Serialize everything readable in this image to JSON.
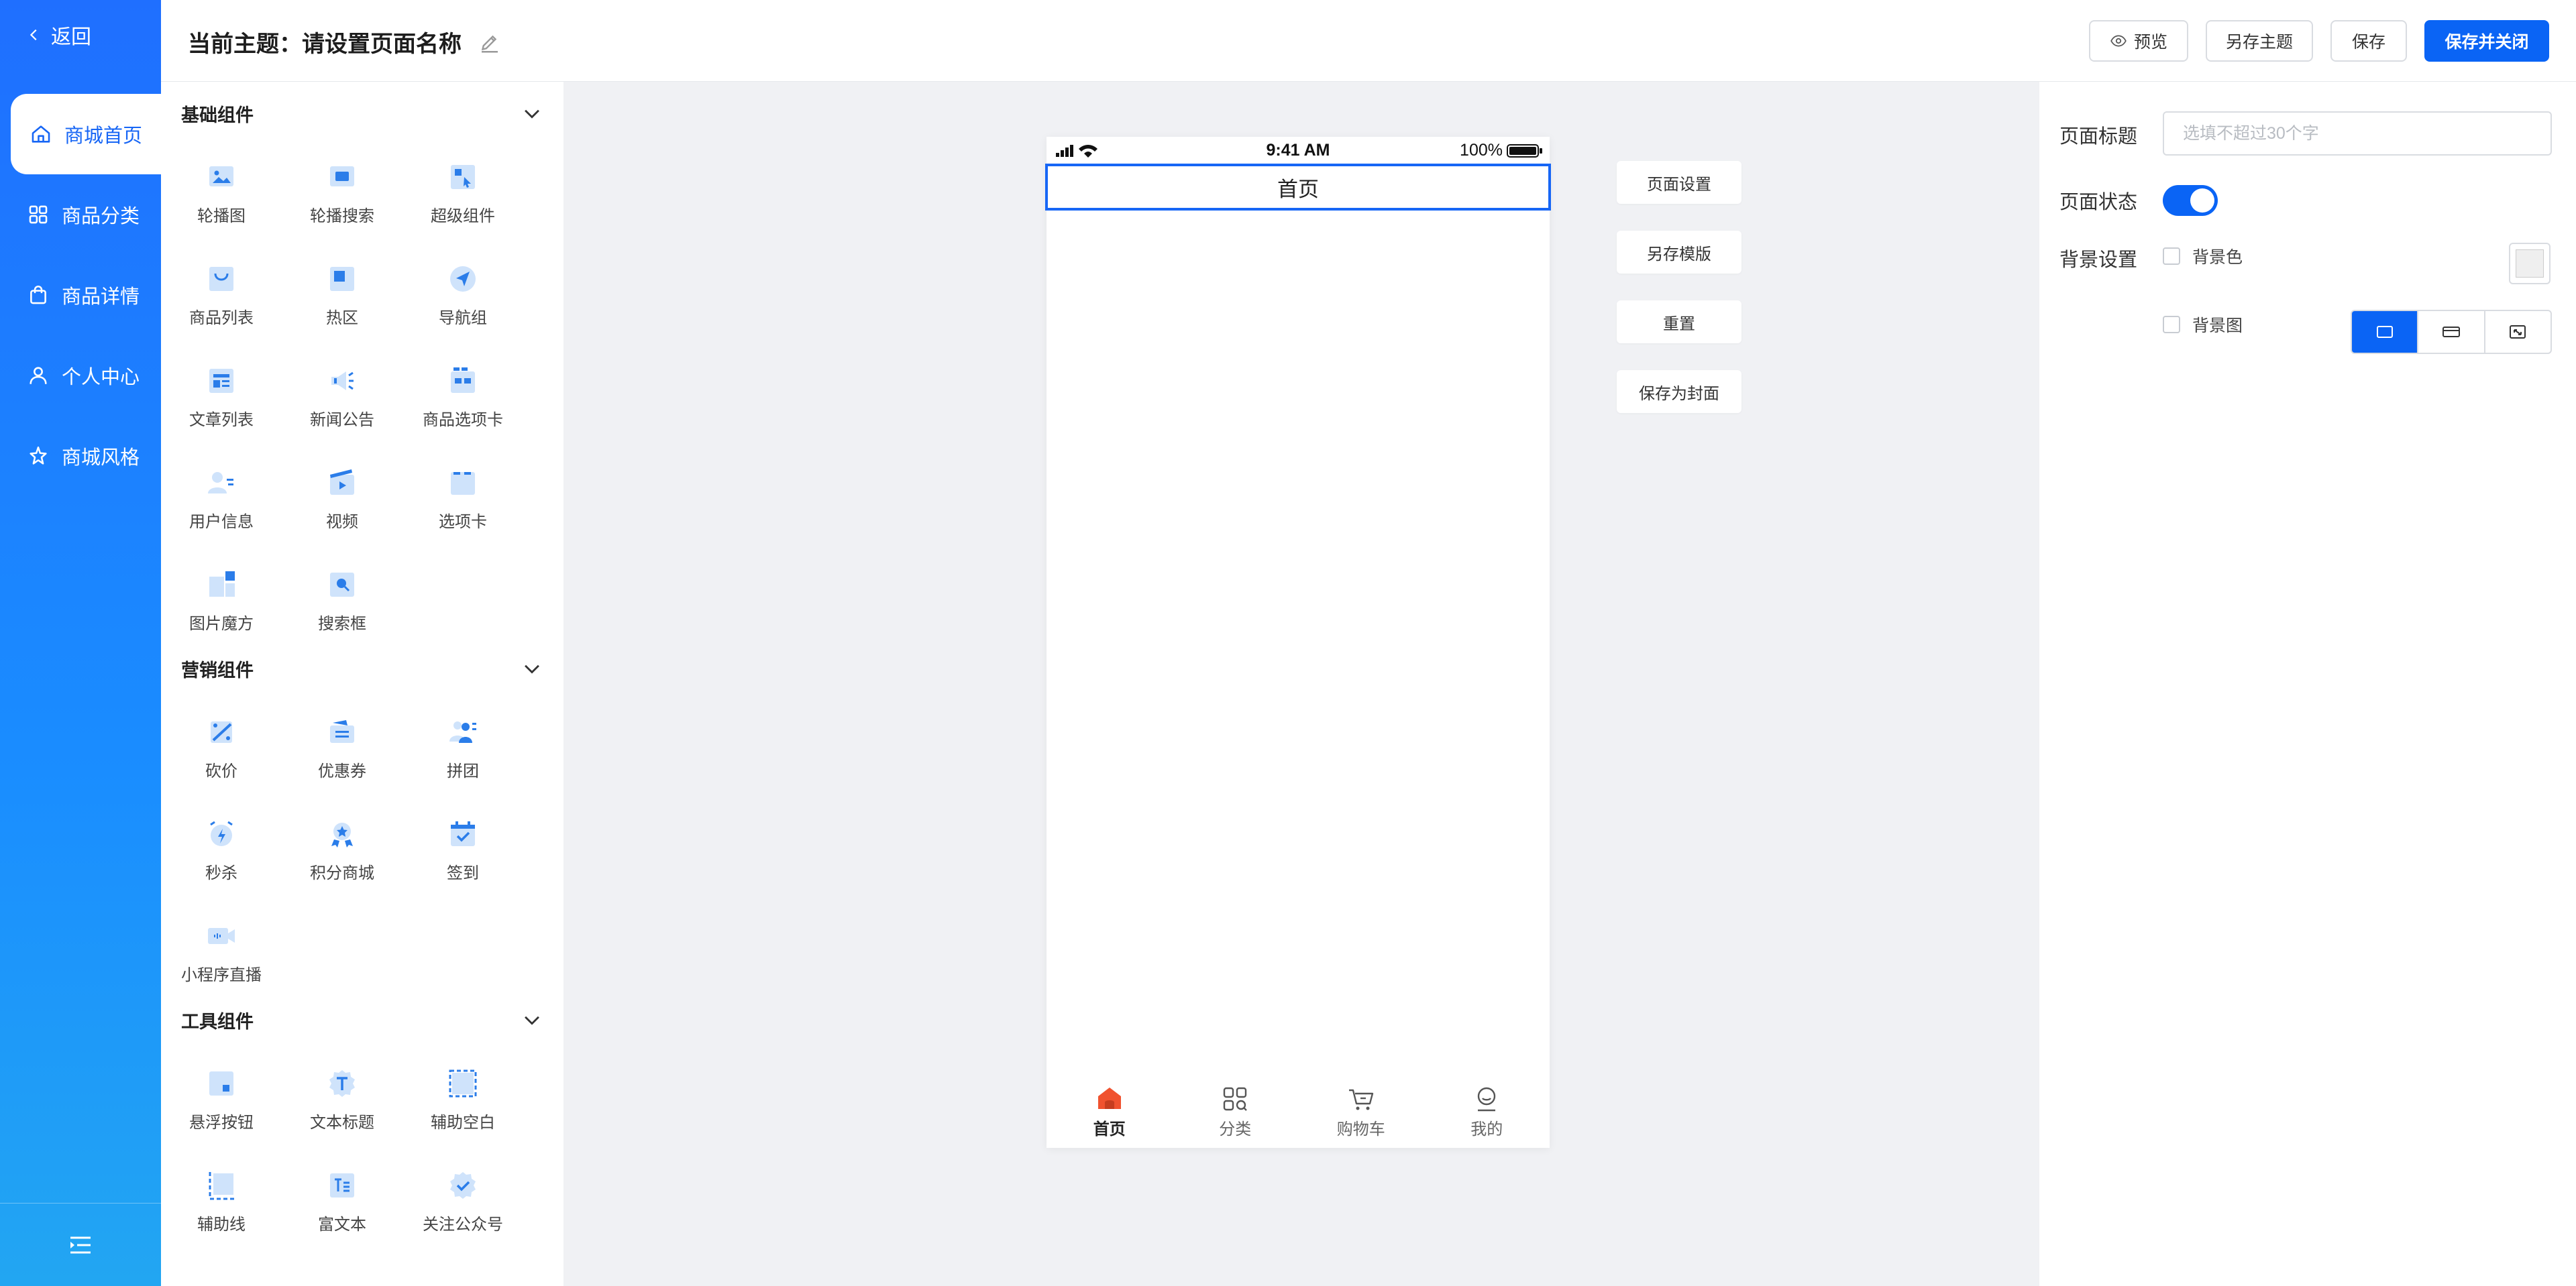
{
  "sidebar": {
    "back_label": "返回",
    "items": [
      {
        "label": "商城首页",
        "icon": "home-icon",
        "active": true
      },
      {
        "label": "商品分类",
        "icon": "grid-icon"
      },
      {
        "label": "商品详情",
        "icon": "bag-icon"
      },
      {
        "label": "个人中心",
        "icon": "user-icon"
      },
      {
        "label": "商城风格",
        "icon": "palette-icon"
      }
    ]
  },
  "header": {
    "title": "当前主题：请设置页面名称",
    "preview_label": "预览",
    "save_as_theme_label": "另存主题",
    "save_label": "保存",
    "save_close_label": "保存并关闭"
  },
  "components": {
    "basic": {
      "title": "基础组件",
      "items": [
        "轮播图",
        "轮播搜索",
        "超级组件",
        "商品列表",
        "热区",
        "导航组",
        "文章列表",
        "新闻公告",
        "商品选项卡",
        "用户信息",
        "视频",
        "选项卡",
        "图片魔方",
        "搜索框"
      ]
    },
    "marketing": {
      "title": "营销组件",
      "items": [
        "砍价",
        "优惠券",
        "拼团",
        "秒杀",
        "积分商城",
        "签到",
        "小程序直播"
      ]
    },
    "tools": {
      "title": "工具组件",
      "items": [
        "悬浮按钮",
        "文本标题",
        "辅助空白",
        "辅助线",
        "富文本",
        "关注公众号"
      ]
    }
  },
  "phone": {
    "time": "9:41 AM",
    "battery": "100%",
    "page_title": "首页",
    "tabs": [
      {
        "label": "首页",
        "icon": "home-filled-icon",
        "active": true
      },
      {
        "label": "分类",
        "icon": "category-icon"
      },
      {
        "label": "购物车",
        "icon": "cart-icon"
      },
      {
        "label": "我的",
        "icon": "profile-icon"
      }
    ]
  },
  "canvas_actions": {
    "page_settings": "页面设置",
    "save_template": "另存模版",
    "reset": "重置",
    "save_cover": "保存为封面"
  },
  "properties": {
    "page_title_label": "页面标题",
    "page_title_placeholder": "选填不超过30个字",
    "page_title_value": "",
    "page_status_label": "页面状态",
    "page_status_on": true,
    "bg_settings_label": "背景设置",
    "bg_color_label": "背景色",
    "bg_image_label": "背景图"
  },
  "colors": {
    "primary": "#0a64f5",
    "sidebar_top": "#1f6fff",
    "sidebar_bottom": "#22a6f2",
    "tab_active_icon": "#f0522f"
  }
}
